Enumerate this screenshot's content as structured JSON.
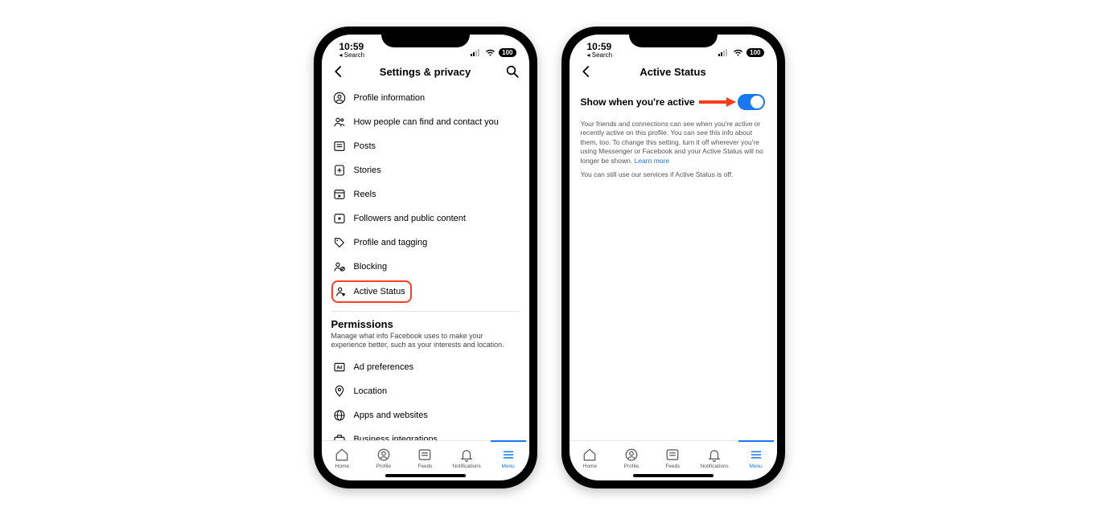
{
  "status": {
    "time": "10:59",
    "back_label": "Search",
    "battery": "100"
  },
  "phone1": {
    "title": "Settings & privacy",
    "rows": [
      "Profile information",
      "How people can find and contact you",
      "Posts",
      "Stories",
      "Reels",
      "Followers and public content",
      "Profile and tagging",
      "Blocking",
      "Active Status"
    ],
    "permissions_title": "Permissions",
    "permissions_sub": "Manage what info Facebook uses to make your experience better, such as your interests and location.",
    "perm_rows": [
      "Ad preferences",
      "Location",
      "Apps and websites",
      "Business integrations"
    ]
  },
  "phone2": {
    "title": "Active Status",
    "setting_label": "Show when you're active",
    "toggle_on": true,
    "desc": "Your friends and connections can see when you're active or recently active on this profile. You can see this info about them, too. To change this setting, turn it off wherever you're using Messenger or Facebook and your Active Status will no longer be shown.",
    "learn_more": "Learn more",
    "desc2": "You can still use our services if Active Status is off."
  },
  "tabs": {
    "items": [
      "Home",
      "Profile",
      "Feeds",
      "Notifications",
      "Menu"
    ],
    "active_index": 4
  }
}
